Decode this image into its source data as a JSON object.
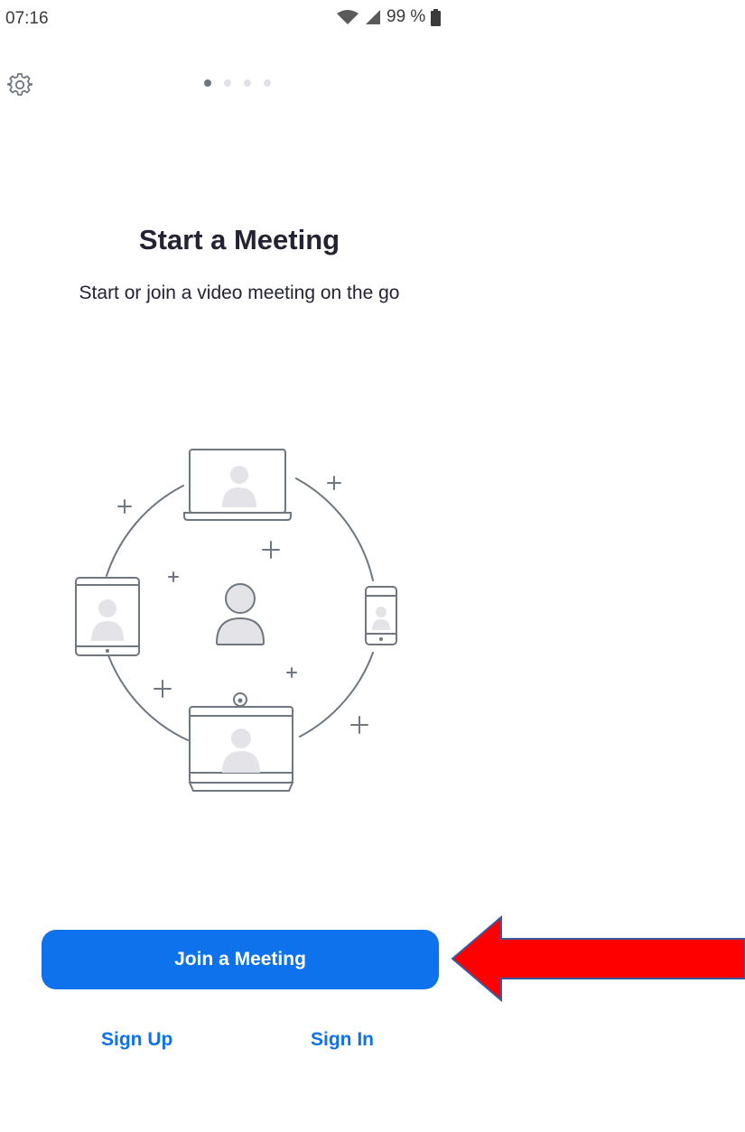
{
  "status_bar": {
    "time": "07:16",
    "battery": "99 %",
    "icons": [
      "wifi-icon",
      "signal-icon",
      "battery-icon"
    ]
  },
  "top_bar": {
    "settings_icon": "gear-icon",
    "pager": {
      "total": 4,
      "active": 1
    }
  },
  "hero": {
    "title": "Start a Meeting",
    "subtitle": "Start or join a video meeting on the go"
  },
  "actions": {
    "join_label": "Join a Meeting",
    "sign_up_label": "Sign Up",
    "sign_in_label": "Sign In"
  },
  "colors": {
    "accent": "#0e72ed",
    "illustration_stroke": "#6e7680",
    "illustration_fill": "#e3e3e8",
    "annotation_arrow": "#ff0000",
    "annotation_arrow_outline": "#3a5aa0"
  }
}
